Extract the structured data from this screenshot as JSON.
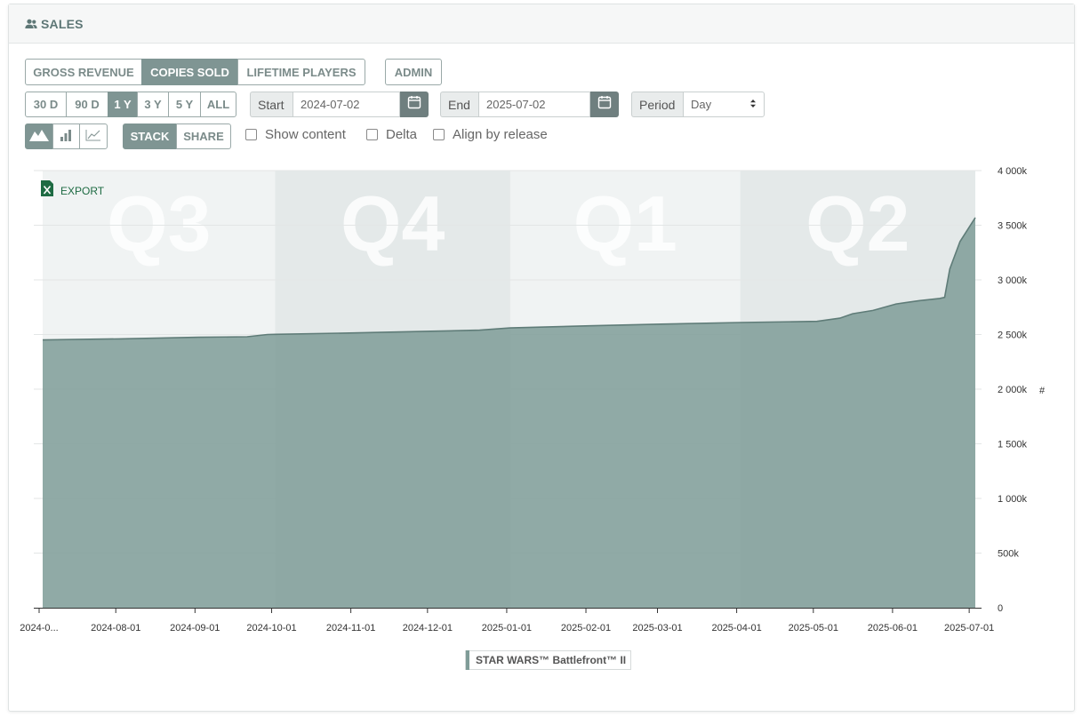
{
  "header": {
    "title": "SALES",
    "icon": "users-icon"
  },
  "metric_tabs": [
    {
      "label": "GROSS REVENUE",
      "active": false
    },
    {
      "label": "COPIES SOLD",
      "active": true
    },
    {
      "label": "LIFETIME PLAYERS",
      "active": false
    }
  ],
  "admin_label": "ADMIN",
  "range_buttons": [
    {
      "label": "30 D",
      "active": false
    },
    {
      "label": "90 D",
      "active": false
    },
    {
      "label": "1 Y",
      "active": true
    },
    {
      "label": "3 Y",
      "active": false
    },
    {
      "label": "5 Y",
      "active": false
    },
    {
      "label": "ALL",
      "active": false
    }
  ],
  "start": {
    "label": "Start",
    "value": "2024-07-02"
  },
  "end": {
    "label": "End",
    "value": "2025-07-02"
  },
  "period": {
    "label": "Period",
    "value": "Day"
  },
  "chart_types": [
    {
      "icon": "area-chart-icon",
      "active": true
    },
    {
      "icon": "bar-chart-icon",
      "active": false
    },
    {
      "icon": "line-chart-icon",
      "active": false
    }
  ],
  "stack_buttons": [
    {
      "label": "STACK",
      "active": true
    },
    {
      "label": "SHARE",
      "active": false
    }
  ],
  "checkboxes": [
    {
      "label": "Show content",
      "checked": false
    },
    {
      "label": "Delta",
      "checked": false
    },
    {
      "label": "Align by release",
      "checked": false
    }
  ],
  "export_label": "EXPORT",
  "chart_data": {
    "type": "area",
    "title": "",
    "xlabel": "",
    "ylabel": "#",
    "x_range": [
      "2024-07-02",
      "2025-07-02"
    ],
    "ylim": [
      0,
      4000000
    ],
    "y_ticks": [
      {
        "value": 0,
        "label": "0"
      },
      {
        "value": 500000,
        "label": "500k"
      },
      {
        "value": 1000000,
        "label": "1 000k"
      },
      {
        "value": 1500000,
        "label": "1 500k"
      },
      {
        "value": 2000000,
        "label": "2 000k"
      },
      {
        "value": 2500000,
        "label": "2 500k"
      },
      {
        "value": 3000000,
        "label": "3 000k"
      },
      {
        "value": 3500000,
        "label": "3 500k"
      },
      {
        "value": 4000000,
        "label": "4 000k"
      }
    ],
    "x_ticks": [
      {
        "date": "2024-07-02",
        "label": "2024-0..."
      },
      {
        "date": "2024-08-01",
        "label": "2024-08-01"
      },
      {
        "date": "2024-09-01",
        "label": "2024-09-01"
      },
      {
        "date": "2024-10-01",
        "label": "2024-10-01"
      },
      {
        "date": "2024-11-01",
        "label": "2024-11-01"
      },
      {
        "date": "2024-12-01",
        "label": "2024-12-01"
      },
      {
        "date": "2025-01-01",
        "label": "2025-01-01"
      },
      {
        "date": "2025-02-01",
        "label": "2025-02-01"
      },
      {
        "date": "2025-03-01",
        "label": "2025-03-01"
      },
      {
        "date": "2025-04-01",
        "label": "2025-04-01"
      },
      {
        "date": "2025-05-01",
        "label": "2025-05-01"
      },
      {
        "date": "2025-06-01",
        "label": "2025-06-01"
      },
      {
        "date": "2025-07-01",
        "label": "2025-07-01"
      }
    ],
    "quarters": [
      {
        "label": "Q3",
        "start": "2024-07-02",
        "end": "2024-10-01"
      },
      {
        "label": "Q4",
        "start": "2024-10-01",
        "end": "2025-01-01"
      },
      {
        "label": "Q1",
        "start": "2025-01-01",
        "end": "2025-04-01"
      },
      {
        "label": "Q2",
        "start": "2025-04-01",
        "end": "2025-07-02"
      }
    ],
    "series": [
      {
        "name": "STAR WARS™ Battlefront™ II",
        "color": "#7f9c98",
        "points": [
          [
            "2024-07-02",
            2450000
          ],
          [
            "2024-08-01",
            2460000
          ],
          [
            "2024-09-01",
            2475000
          ],
          [
            "2024-09-20",
            2480000
          ],
          [
            "2024-09-28",
            2500000
          ],
          [
            "2024-10-01",
            2502000
          ],
          [
            "2024-11-01",
            2515000
          ],
          [
            "2024-12-01",
            2530000
          ],
          [
            "2024-12-20",
            2540000
          ],
          [
            "2025-01-01",
            2560000
          ],
          [
            "2025-02-01",
            2580000
          ],
          [
            "2025-03-01",
            2595000
          ],
          [
            "2025-04-01",
            2610000
          ],
          [
            "2025-05-01",
            2620000
          ],
          [
            "2025-05-10",
            2650000
          ],
          [
            "2025-05-15",
            2690000
          ],
          [
            "2025-05-23",
            2720000
          ],
          [
            "2025-06-01",
            2780000
          ],
          [
            "2025-06-10",
            2810000
          ],
          [
            "2025-06-18",
            2830000
          ],
          [
            "2025-06-20",
            2840000
          ],
          [
            "2025-06-22",
            3100000
          ],
          [
            "2025-06-26",
            3350000
          ],
          [
            "2025-07-02",
            3570000
          ]
        ]
      }
    ],
    "legend_position": "bottom-center"
  }
}
